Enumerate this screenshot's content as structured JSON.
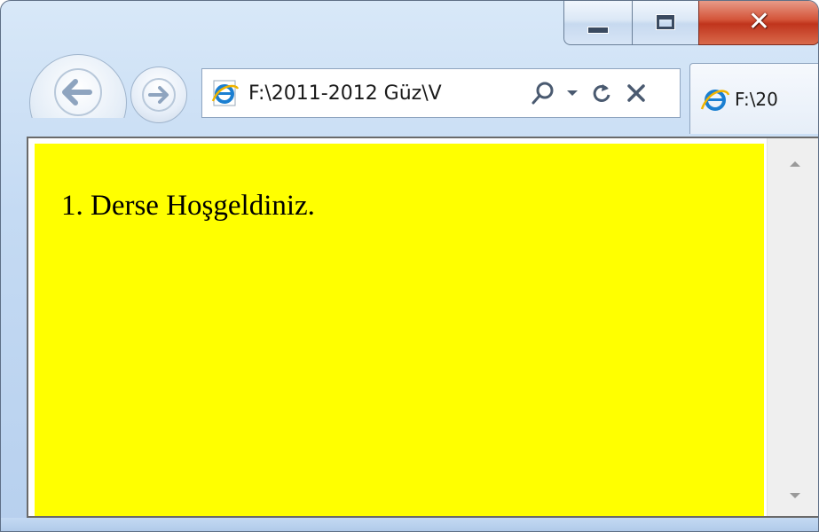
{
  "window": {
    "address": "F:\\2011-2012 Güz\\V",
    "tab_label": "F:\\20"
  },
  "page": {
    "text": "1. Derse Hoşgeldiniz.",
    "background_color": "#ffff00"
  },
  "icons": {
    "back": "back-arrow-icon",
    "forward": "forward-arrow-icon",
    "site": "internet-explorer-icon",
    "search": "search-icon",
    "dropdown": "chevron-down-icon",
    "refresh": "refresh-icon",
    "stop": "close-icon",
    "minimize": "minimize-icon",
    "maximize": "maximize-icon",
    "close": "close-icon"
  }
}
